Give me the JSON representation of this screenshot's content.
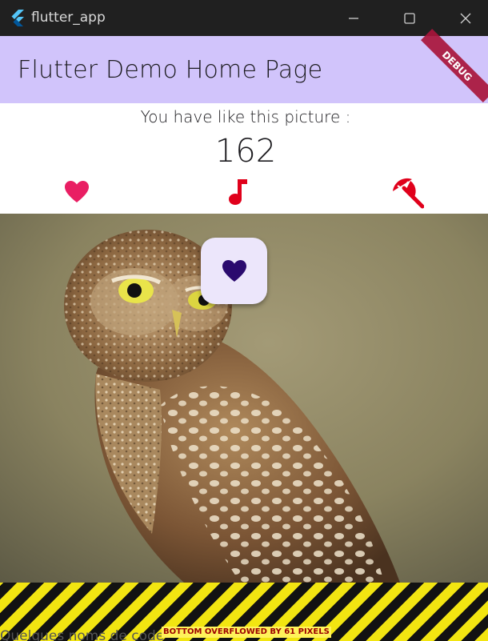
{
  "window": {
    "title": "flutter_app",
    "icon": "flutter-logo-icon",
    "controls": [
      "minimize-icon",
      "maximize-icon",
      "close-icon"
    ]
  },
  "appbar": {
    "title": "Flutter Demo Home Page",
    "debug_banner": "DEBUG",
    "background": "#d1c4fb"
  },
  "body": {
    "like_text": "You have like this picture :",
    "count": "162",
    "icons": [
      {
        "name": "heart-icon",
        "color": "#e91e63"
      },
      {
        "name": "music-note-icon",
        "color": "#e0001b"
      },
      {
        "name": "beach-umbrella-icon",
        "color": "#e0001b"
      }
    ]
  },
  "picture": {
    "subject": "owl-photo",
    "fab_icon": "heart-icon",
    "fab_icon_color": "#2a0a6e"
  },
  "overflow": {
    "label": "BOTTOM OVERFLOWED BY 61 PIXELS",
    "behind_text": "Quelques noms de code"
  }
}
